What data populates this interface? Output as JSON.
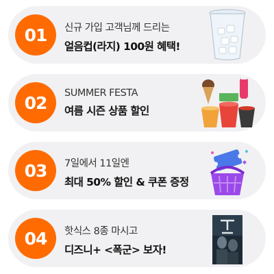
{
  "promotions": [
    {
      "number": "01",
      "line1": "신규 가입 고객님께 드리는",
      "line2": "얼음컵(라지) 100원 혜택!",
      "image": "ice-cup-image"
    },
    {
      "number": "02",
      "line1": "SUMMER FESTA",
      "line2": "여름 시즌 상품 할인",
      "image": "summer-products-image"
    },
    {
      "number": "03",
      "line1": "7일에서 11일엔",
      "line2": "최대 50% 할인 & 쿠폰 증정",
      "image": "gift-basket-image"
    },
    {
      "number": "04",
      "line1": "핫식스 8종 마시고",
      "line2": "디즈니+ <폭군> 보자!",
      "image": "movie-poster-image"
    }
  ],
  "colors": {
    "badge": "#ff6b00",
    "card": "#f1f1f3"
  }
}
